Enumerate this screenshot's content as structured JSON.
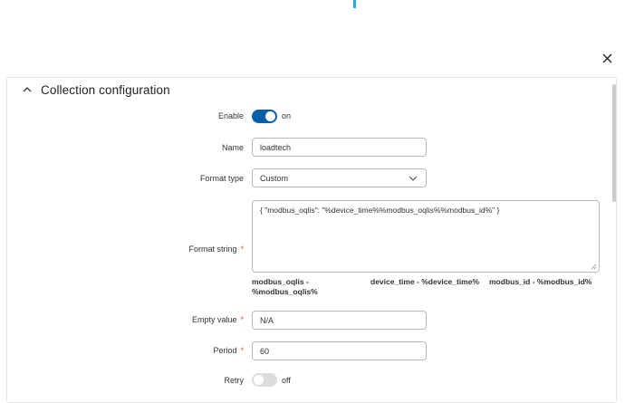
{
  "panel": {
    "title": "Collection configuration"
  },
  "form": {
    "enable": {
      "label": "Enable",
      "state": "on"
    },
    "name": {
      "label": "Name",
      "value": "loadtech"
    },
    "format_type": {
      "label": "Format type",
      "value": "Custom"
    },
    "format_string": {
      "label": "Format string",
      "value": "{ \"modbus_oqlis\": \"%device_time%%modbus_oqlis%%modbus_id%\" }",
      "hints": [
        {
          "line1": "modbus_oqlis -",
          "line2": "%modbus_oqlis%"
        },
        {
          "line1": "device_time - %device_time%",
          "line2": ""
        },
        {
          "line1": "modbus_id - %modbus_id%",
          "line2": ""
        }
      ]
    },
    "empty_value": {
      "label": "Empty value",
      "value": "N/A"
    },
    "period": {
      "label": "Period",
      "value": "60"
    },
    "retry": {
      "label": "Retry",
      "state": "off"
    }
  },
  "colors": {
    "accent": "#0b5ea8",
    "required": "#e0483e",
    "top_indicator": "#29a8e0"
  },
  "icons": [
    "close-icon",
    "chevron-up-icon",
    "chevron-down-icon"
  ]
}
